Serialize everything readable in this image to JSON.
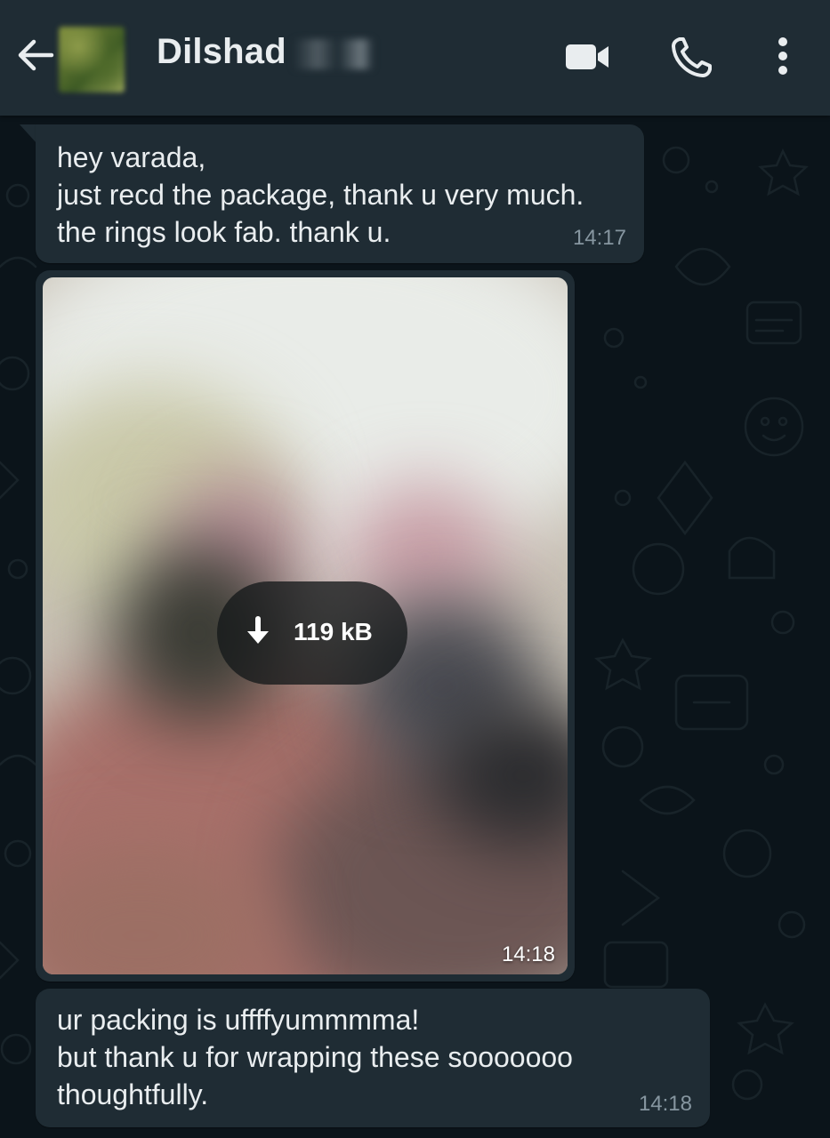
{
  "header": {
    "contact_name": "Dilshad",
    "icons": {
      "back": "arrow-left-icon",
      "video": "video-camera-icon",
      "call": "phone-icon",
      "menu": "more-vertical-icon"
    }
  },
  "messages": [
    {
      "type": "text",
      "text": "hey varada,\njust recd the package, thank u very much.\nthe rings look fab. thank u.",
      "time": "14:17"
    },
    {
      "type": "image",
      "download_size": "119 kB",
      "download_icon": "download-arrow-icon",
      "time": "14:18"
    },
    {
      "type": "text",
      "text": "ur packing is uffffyummmma!\nbut thank u for wrapping these sooooooo\nthoughtfully.",
      "time": "14:18"
    }
  ],
  "colors": {
    "background": "#0b141a",
    "header": "#1f2c34",
    "bubble": "#1f2c34",
    "text": "#e9edef",
    "meta": "#8696a0"
  }
}
